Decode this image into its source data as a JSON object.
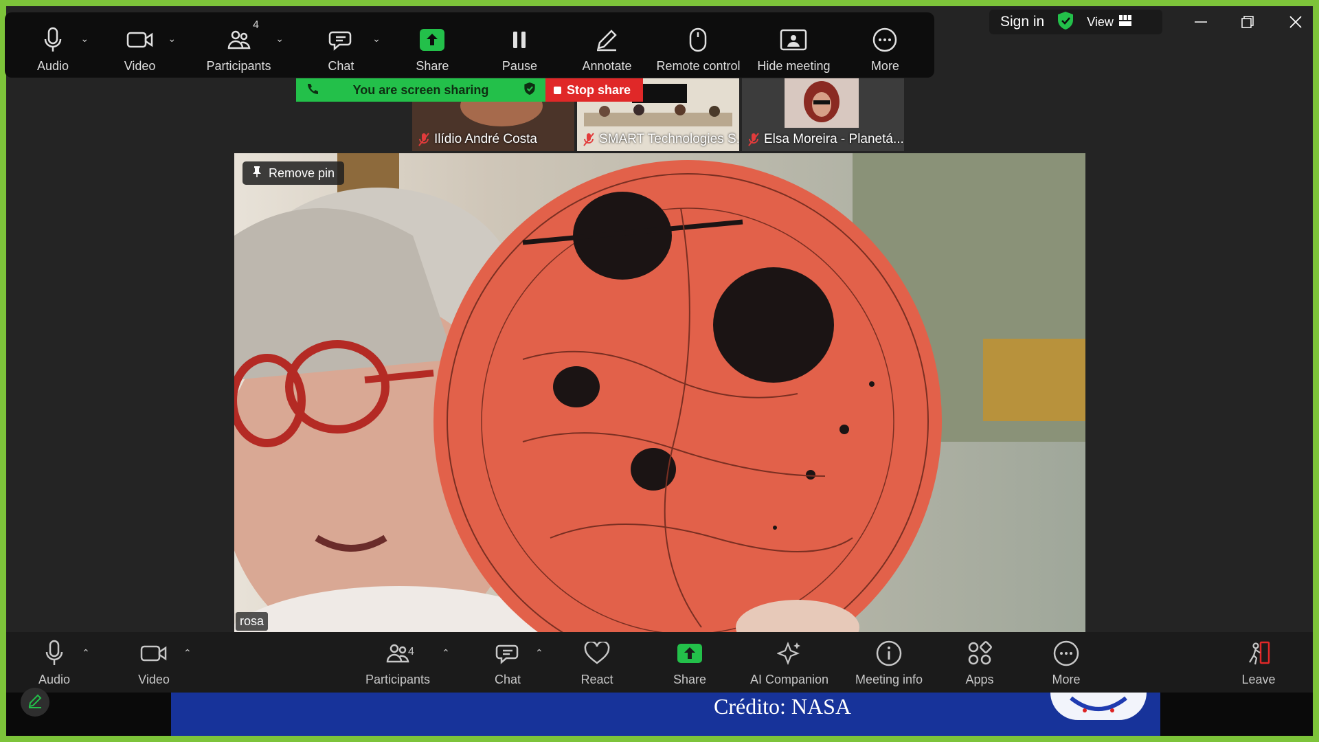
{
  "share_toolbar": {
    "audio": "Audio",
    "video": "Video",
    "participants": "Participants",
    "participants_count": "4",
    "chat": "Chat",
    "share": "Share",
    "pause": "Pause",
    "annotate": "Annotate",
    "remote_control": "Remote control",
    "hide_meeting": "Hide meeting",
    "more": "More"
  },
  "top_right": {
    "sign_in": "Sign in",
    "view": "View"
  },
  "banner": {
    "sharing_text": "You are screen sharing",
    "stop_share": "Stop share"
  },
  "thumbnails": [
    {
      "name": "Ilídio André Costa"
    },
    {
      "name": "SMART Technologies S..."
    },
    {
      "name": "Elsa Moreira - Planetá..."
    }
  ],
  "main_video": {
    "pin_label": "Remove pin",
    "speaker_name": "rosa"
  },
  "bottom_toolbar": {
    "audio": "Audio",
    "video": "Video",
    "participants": "Participants",
    "participants_count": "4",
    "chat": "Chat",
    "react": "React",
    "share": "Share",
    "ai_companion": "AI Companion",
    "meeting_info": "Meeting info",
    "apps": "Apps",
    "more": "More",
    "leave": "Leave"
  },
  "shared_screen": {
    "credit": "Crédito: NASA"
  },
  "colors": {
    "frame_border": "#7dc43a",
    "share_green": "#23c04a",
    "stop_red": "#e02828",
    "toolbar_bg": "#0d0d0d",
    "bottom_bg": "#1b1b1b",
    "slide_blue": "#17339a"
  }
}
